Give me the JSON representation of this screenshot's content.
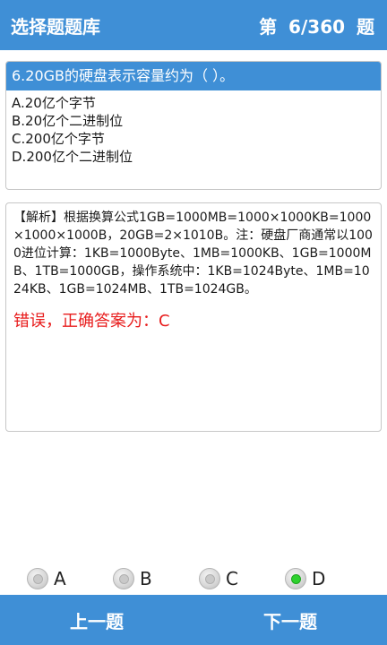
{
  "header": {
    "title": "选择题题库",
    "progress": "第 6/360 题"
  },
  "question": {
    "text": "6.20GB的硬盘表示容量约为（ ）。",
    "options": [
      "A.20亿个字节",
      "B.20亿个二进制位",
      "C.200亿个字节",
      "D.200亿个二进制位"
    ]
  },
  "analysis": {
    "text": "【解析】根据换算公式1GB=1000MB=1000×1000KB=1000×1000×1000B，20GB=2×1010B。注：硬盘厂商通常以1000进位计算：1KB=1000Byte、1MB=1000KB、1GB=1000MB、1TB=1000GB，操作系统中：1KB=1024Byte、1MB=1024KB、1GB=1024MB、1TB=1024GB。",
    "result": "错误，正确答案为：C"
  },
  "answers": {
    "a": "A",
    "b": "B",
    "c": "C",
    "d": "D",
    "selected": "D"
  },
  "footer": {
    "prev_label": "上一题",
    "next_label": "下一题"
  },
  "colors": {
    "accent": "#3f8fd6",
    "error": "#e81c1c",
    "selected_radio": "#2ed12e"
  }
}
